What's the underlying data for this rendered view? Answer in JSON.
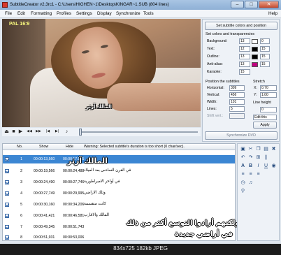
{
  "window": {
    "title": "SubtitleCreator v2.3rc1 - C:\\Users\\HIGHEN~1\\Desktop\\KINGAR~1.SUB (804 lines)",
    "controls": {
      "minimize": "–",
      "maximize": "□",
      "close": "✕"
    }
  },
  "menu": [
    "File",
    "Edit",
    "Formatting",
    "Profiles",
    "Settings",
    "Display",
    "Synchronize",
    "Tools",
    "Help"
  ],
  "video": {
    "format_label": "PAL 16:9",
    "subtitle_text": "المالك آرثر"
  },
  "player": {
    "icons": [
      "eject-icon",
      "stop-icon",
      "play-icon",
      "rewind-icon",
      "fast-forward-icon",
      "skip-start-icon",
      "skip-end-icon",
      "volume-icon"
    ],
    "glyphs": [
      "⏏",
      "■",
      "▶",
      "◀◀",
      "▶▶",
      "|◀",
      "▶|",
      "♪"
    ]
  },
  "panel": {
    "set_colors_button": "Set subtitle colors and position",
    "colors_section": "Set colors and transparencies",
    "color_rows": [
      {
        "label": "Background:",
        "value": "13",
        "swatch": "#ffffff",
        "value2": "0"
      },
      {
        "label": "Text:",
        "value": "12",
        "swatch": "#000000",
        "value2": "15"
      },
      {
        "label": "Outline:",
        "value": "13",
        "swatch": "#000000",
        "value2": "15"
      },
      {
        "label": "Anti-alias:",
        "value": "13",
        "swatch": "#c00080",
        "value2": "15"
      }
    ],
    "karaoke_label": "Karaoke:",
    "karaoke_value": "15",
    "position_section": "Position the subtitles",
    "horizontal_label": "Horizontal:",
    "horizontal_value": "309",
    "vertical_label": "Vertical:",
    "vertical_value": "456",
    "width_label": "Width:",
    "width_value": "101",
    "lines_label": "Lines:",
    "lines_value": "5",
    "shift_label": "Shift vert.:",
    "stretch_section": "Stretch",
    "x_label": "X:",
    "x_value": "0.70",
    "y_label": "Y:",
    "y_value": "1.00",
    "line_height_section": "Line height",
    "line_height_value": "0",
    "edit_this_label": "Edit this",
    "apply_button": "Apply",
    "sync_button": "Synchronize DVD"
  },
  "list": {
    "headers": {
      "no": "No.",
      "show": "Show",
      "hide": "Hide",
      "text": "Warning: Selected subtitle's duration is too short (0 char/sec)."
    },
    "rows": [
      {
        "no": "1",
        "show": "00:00:13,560",
        "hide": "00:00:17,925",
        "text": "المالك آرثر"
      },
      {
        "no": "2",
        "show": "00:00:19,566",
        "hide": "00:00:24,488",
        "text": "في القرن السادس بعد الميلاد"
      },
      {
        "no": "3",
        "show": "00:00:24,490",
        "hide": "00:00:27,746",
        "text": "في أواخر الامبراطورية"
      },
      {
        "no": "4",
        "show": "00:00:27,749",
        "hide": "00:00:29,995",
        "text": "وتلك الاراضي"
      },
      {
        "no": "5",
        "show": "00:00:30,160",
        "hide": "00:00:34,206",
        "text": "كانت منقسمة"
      },
      {
        "no": "6",
        "show": "00:00:41,421",
        "hide": "00:00:46,581",
        "text": "المالك والاقارب"
      },
      {
        "no": "7",
        "show": "00:00:49,345",
        "hide": "00:00:51,743",
        "text": "ولكنهم أرادوا التوسع أكثر من ذلك"
      },
      {
        "no": "8",
        "show": "00:00:51,931",
        "hide": "00:00:53,006",
        "text": "في أراضي جديدة"
      }
    ]
  },
  "overlay": [
    {
      "text": "المالك آرثر"
    },
    {
      "text": "ولكنهم أرادوا التوسع أكثر من ذلك"
    },
    {
      "text": "في أراضي جديدة"
    }
  ],
  "caption": "834x725  182kb  JPEG"
}
